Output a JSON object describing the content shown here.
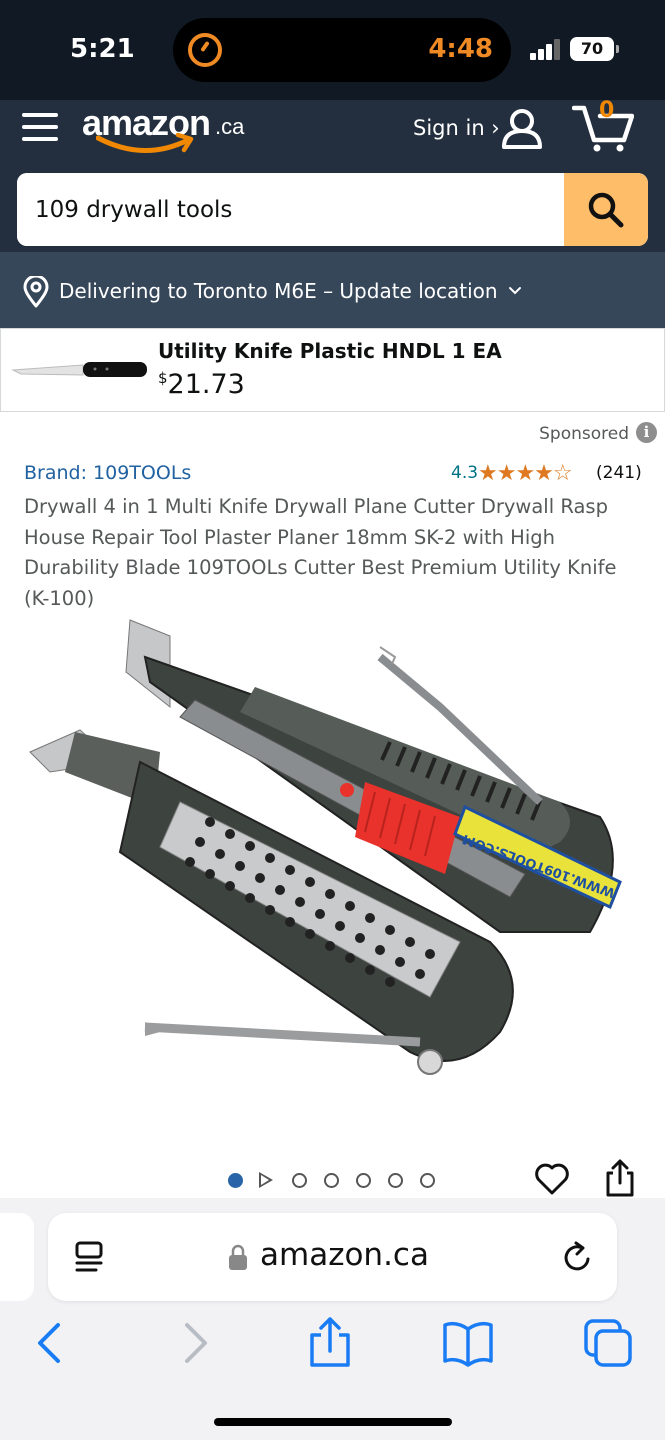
{
  "status_bar": {
    "time": "5:21",
    "timer_time": "4:48",
    "battery": "70",
    "timer_color": "#f08a24"
  },
  "header": {
    "logo_word": "amazon",
    "logo_tld": ".ca",
    "signin_label": "Sign in ›",
    "cart_count": "0",
    "accent_color": "#febd69"
  },
  "search": {
    "query": "109 drywall tools"
  },
  "delivery": {
    "text": "Delivering to Toronto M6E – Update location"
  },
  "ad": {
    "title": "Utility Knife Plastic HNDL 1 EA",
    "price_symbol": "$",
    "price": "21.73"
  },
  "product": {
    "sponsored_label": "Sponsored",
    "info_glyph": "i",
    "brand": "Brand: 109TOOLs",
    "rating": "4.3",
    "rating_value": 4.3,
    "stars": "★★★★☆",
    "rating_count": "(241)",
    "title": "Drywall 4 in 1 Multi Knife Drywall Plane Cutter Drywall Rasp House Repair Tool Plaster Planer 18mm SK-2 with High Durability Blade 109TOOLs Cutter Best Premium Utility Knife (K-100)",
    "image_label": "WWW.109TOOLS.COM",
    "carousel_total": 7,
    "carousel_active": 1
  },
  "safari": {
    "address": "amazon.ca"
  }
}
